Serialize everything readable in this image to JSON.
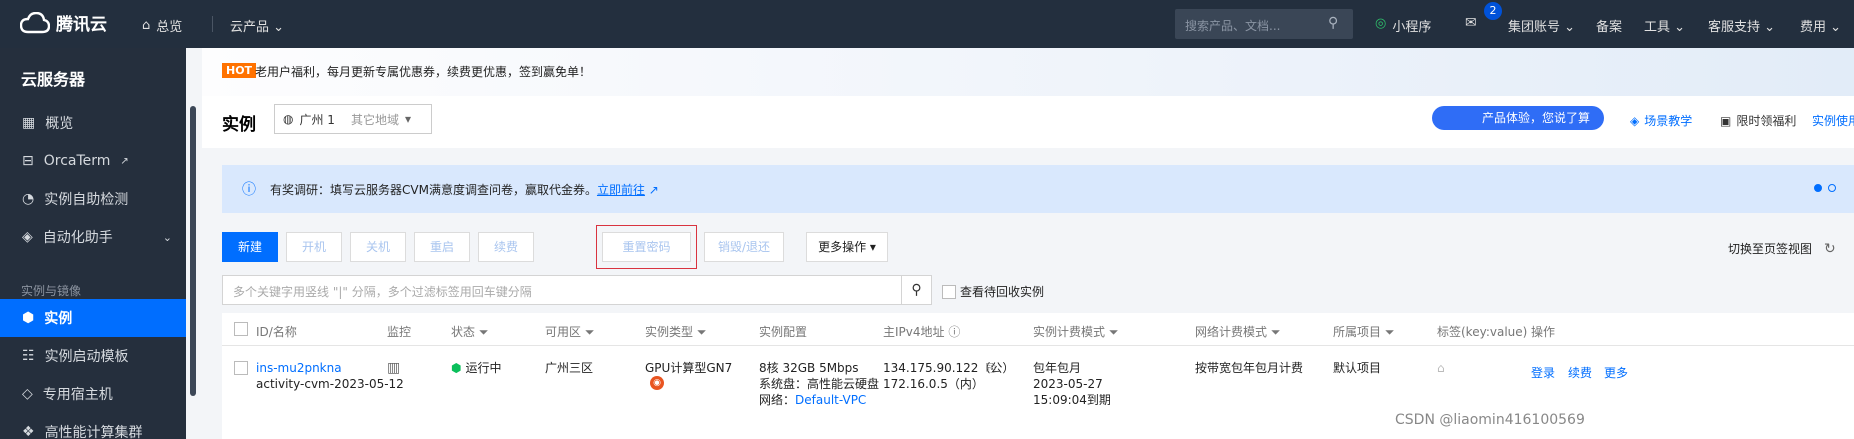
{
  "topbar": {
    "brand": "腾讯云",
    "overview": "总览",
    "products": "云产品",
    "search_placeholder": "搜索产品、文档...",
    "mini_program": "小程序",
    "mail_count": "2",
    "group_account": "集团账号",
    "filing": "备案",
    "tools": "工具",
    "support": "客服支持",
    "billing": "费用"
  },
  "sidebar": {
    "title": "云服务器",
    "items": [
      {
        "label": "概览"
      },
      {
        "label": "OrcaTerm"
      },
      {
        "label": "实例自助检测"
      },
      {
        "label": "自动化助手"
      }
    ],
    "group_label": "实例与镜像",
    "group_items": [
      {
        "label": "实例"
      },
      {
        "label": "实例启动模板"
      },
      {
        "label": "专用宿主机"
      },
      {
        "label": "高性能计算集群"
      }
    ]
  },
  "promo": {
    "tag": "HOT",
    "text": "老用户福利，每月更新专属优惠券，续费更优惠，签到赢免单！"
  },
  "header": {
    "title": "实例",
    "region": "广州 1",
    "other_regions": "其它地域",
    "experience_button": "产品体验，您说了算",
    "scene_teaching": "场景教学",
    "limited_benefit": "限时领福利",
    "instance_usage": "实例使用"
  },
  "notice": {
    "text": "有奖调研：填写云服务器CVM满意度调查问卷，赢取代金券。",
    "link": "立即前往"
  },
  "toolbar": {
    "new": "新建",
    "start": "开机",
    "shutdown": "关机",
    "restart": "重启",
    "renew": "续费",
    "reset_password": "重置密码",
    "destroy": "销毁/退还",
    "more": "更多操作",
    "switch_tab_view": "切换至页签视图"
  },
  "filter": {
    "placeholder": "多个关键字用竖线 \"|\" 分隔，多个过滤标签用回车键分隔",
    "recycle": "查看待回收实例"
  },
  "table": {
    "columns": [
      "ID/名称",
      "监控",
      "状态",
      "可用区",
      "实例类型",
      "实例配置",
      "主IPv4地址",
      "实例计费模式",
      "网络计费模式",
      "所属项目",
      "标签(key:value)",
      "操作"
    ],
    "row": {
      "id": "ins-mu2pnkna",
      "name": "activity-cvm-2023-05-12",
      "status": "运行中",
      "zone": "广州三区",
      "type": "GPU计算型GN7",
      "config_line1": "8核 32GB 5Mbps",
      "config_line2": "系统盘：高性能云硬盘",
      "config_line3_label": "网络：",
      "config_line3_link": "Default-VPC",
      "ip_public": "134.175.90.122（公）",
      "ip_private": "172.16.0.5（内）",
      "billing_line1": "包年包月",
      "billing_line2": "2023-05-27",
      "billing_line3": "15:09:04到期",
      "network_billing": "按带宽包年包月计费",
      "project": "默认项目",
      "actions": [
        "登录",
        "续费",
        "更多"
      ]
    }
  },
  "watermark": "CSDN @liaomin416100569"
}
